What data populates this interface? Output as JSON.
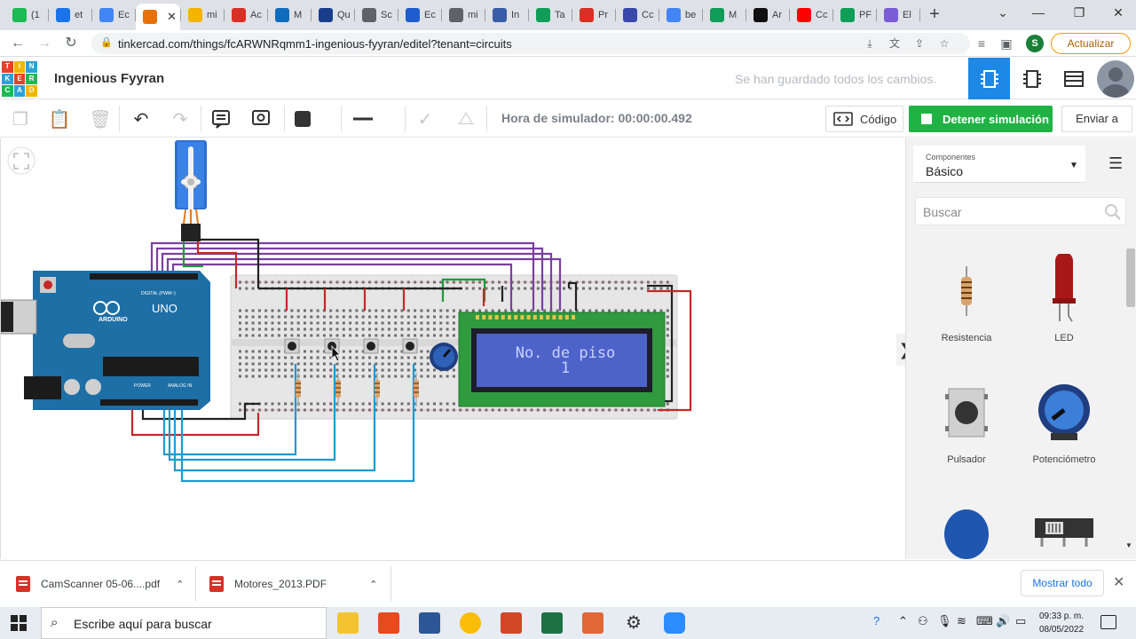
{
  "browser": {
    "tabs": [
      {
        "label": "(1",
        "color": "#1db954"
      },
      {
        "label": "et",
        "color": "#1a73e8"
      },
      {
        "label": "Ec",
        "color": "#4285f4"
      },
      {
        "label": "",
        "color": "#e8710a",
        "active": true
      },
      {
        "label": "mi",
        "color": "#f4b400"
      },
      {
        "label": "Ac",
        "color": "#d93025"
      },
      {
        "label": "M",
        "color": "#0f6cbd"
      },
      {
        "label": "Qu",
        "color": "#1a3e8c"
      },
      {
        "label": "Sc",
        "color": "#5f6368"
      },
      {
        "label": "Ec",
        "color": "#1e5ccf"
      },
      {
        "label": "mi",
        "color": "#5f6368"
      },
      {
        "label": "In",
        "color": "#3a5da8"
      },
      {
        "label": "Ta",
        "color": "#0f9d58"
      },
      {
        "label": "Pr",
        "color": "#d93025"
      },
      {
        "label": "Cc",
        "color": "#3949ab"
      },
      {
        "label": "be",
        "color": "#4285f4"
      },
      {
        "label": "M",
        "color": "#0f9d58"
      },
      {
        "label": "Ar",
        "color": "#111111"
      },
      {
        "label": "Cc",
        "color": "#ff0000"
      },
      {
        "label": "PF",
        "color": "#0f9d58"
      },
      {
        "label": "El",
        "color": "#7b5cd6"
      }
    ],
    "url": "tinkercad.com/things/fcARWNRqmm1-ingenious-fyyran/editel?tenant=circuits",
    "profile_initial": "S",
    "update_label": "Actualizar"
  },
  "app": {
    "logo_letters": [
      "TIN",
      "KER",
      "CAD"
    ],
    "title": "Ingenious Fyyran",
    "saved_message": "Se han guardado todos los cambios."
  },
  "toolbar": {
    "sim_time": "Hora de simulador: 00:00:00.492",
    "code_label": "Código",
    "stop_label": "Detener simulación",
    "send_label": "Enviar a"
  },
  "lcd": {
    "line1": "No. de piso",
    "line2": "1"
  },
  "arduino": {
    "brand": "ARDUINO",
    "model": "UNO",
    "digital_label": "DIGITAL (PWM~)",
    "power_label": "POWER",
    "analog_label": "ANALOG IN"
  },
  "panel": {
    "components_label": "Componentes",
    "selected": "Básico",
    "search_placeholder": "Buscar",
    "items": [
      {
        "name": "Resistencia"
      },
      {
        "name": "LED"
      },
      {
        "name": "Pulsador"
      },
      {
        "name": "Potenciómetro"
      }
    ]
  },
  "downloads": {
    "items": [
      {
        "name": "CamScanner 05-06....pdf"
      },
      {
        "name": "Motores_2013.PDF"
      }
    ],
    "show_all": "Mostrar todo"
  },
  "taskbar": {
    "search_placeholder": "Escribe aquí para buscar",
    "time": "09:33 p. m.",
    "date": "08/05/2022"
  }
}
